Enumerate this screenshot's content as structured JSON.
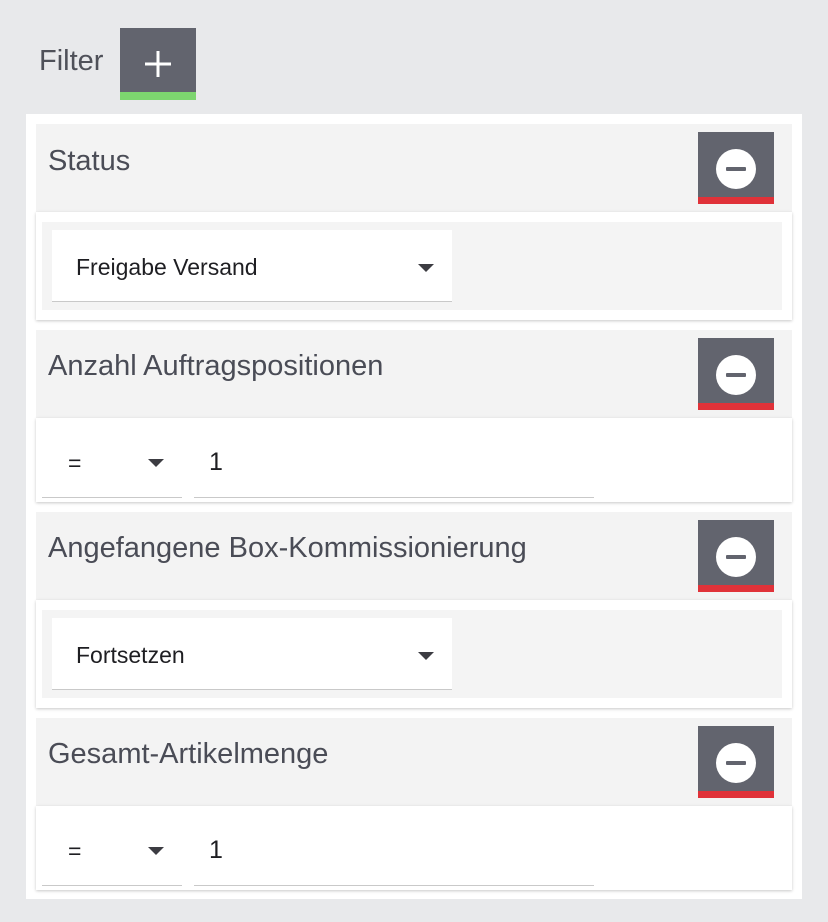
{
  "filter": {
    "title": "Filter",
    "add_icon": "plus-icon",
    "colors": {
      "add_accent": "#7dd56f",
      "remove_accent": "#e03239",
      "button_bg": "#62646e"
    }
  },
  "blocks": [
    {
      "title": "Status",
      "type": "select",
      "value": "Freigabe Versand",
      "remove_icon": "minus-circle-icon"
    },
    {
      "title": "Anzahl Auftragspositionen",
      "type": "comparison",
      "operator": "=",
      "value": "1",
      "remove_icon": "minus-circle-icon"
    },
    {
      "title": "Angefangene Box-Kommissionierung",
      "type": "select",
      "value": "Fortsetzen",
      "remove_icon": "minus-circle-icon"
    },
    {
      "title": "Gesamt-Artikelmenge",
      "type": "comparison",
      "operator": "=",
      "value": "1",
      "remove_icon": "minus-circle-icon"
    }
  ]
}
